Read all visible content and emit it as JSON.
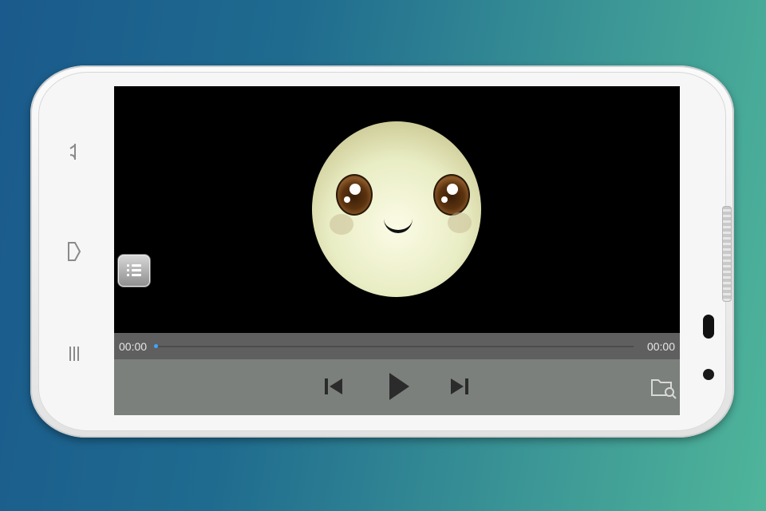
{
  "player": {
    "current_time": "00:00",
    "duration": "00:00",
    "progress": 0
  },
  "controls": {
    "previous_icon": "skip-previous-icon",
    "play_icon": "play-icon",
    "next_icon": "skip-next-icon",
    "browse_icon": "folder-search-icon",
    "menu_icon": "list-menu-icon"
  },
  "device": {
    "nav_buttons": [
      "back-icon",
      "home-icon",
      "recent-apps-icon"
    ]
  },
  "colors": {
    "background_start": "#1a5a8c",
    "background_end": "#4fb59a",
    "time_bar": "#5f5f5f",
    "control_bar": "#7b807c",
    "seek_knob": "#3fa6ff"
  }
}
